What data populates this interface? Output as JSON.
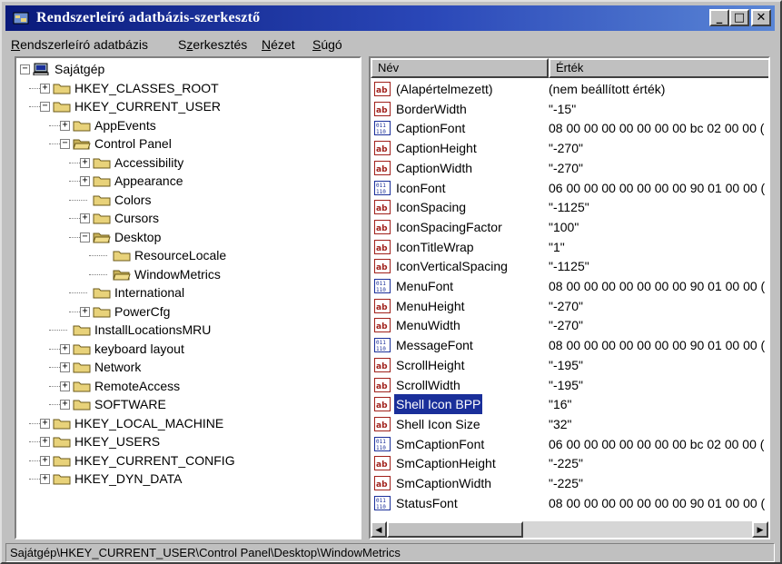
{
  "window": {
    "title": "Rendszerleíró adatbázis-szerkesztő",
    "controls": {
      "minimize": "_",
      "maximize": "□",
      "close": "✕"
    }
  },
  "menu": [
    {
      "label": "Rendszerleíró adatbázis",
      "accel": "R",
      "rest": "endszerleíró adatbázis"
    },
    {
      "label": "Szerkesztés",
      "accel": "z",
      "pre": "S",
      "rest": "erkesztés"
    },
    {
      "label": "Nézet",
      "accel": "N",
      "rest": "ézet"
    },
    {
      "label": "Súgó",
      "accel": "S",
      "rest": "úgó"
    }
  ],
  "tree": [
    {
      "label": "Sajátgép",
      "depth": 0,
      "expander": "−",
      "icon": "computer-icon"
    },
    {
      "label": "HKEY_CLASSES_ROOT",
      "depth": 1,
      "expander": "+",
      "icon": "folder-icon"
    },
    {
      "label": "HKEY_CURRENT_USER",
      "depth": 1,
      "expander": "−",
      "icon": "folder-icon"
    },
    {
      "label": "AppEvents",
      "depth": 2,
      "expander": "+",
      "icon": "folder-icon"
    },
    {
      "label": "Control Panel",
      "depth": 2,
      "expander": "−",
      "icon": "folder-open-icon"
    },
    {
      "label": "Accessibility",
      "depth": 3,
      "expander": "+",
      "icon": "folder-icon"
    },
    {
      "label": "Appearance",
      "depth": 3,
      "expander": "+",
      "icon": "folder-icon"
    },
    {
      "label": "Colors",
      "depth": 3,
      "expander": "",
      "icon": "folder-icon"
    },
    {
      "label": "Cursors",
      "depth": 3,
      "expander": "+",
      "icon": "folder-icon"
    },
    {
      "label": "Desktop",
      "depth": 3,
      "expander": "−",
      "icon": "folder-open-icon"
    },
    {
      "label": "ResourceLocale",
      "depth": 4,
      "expander": "",
      "icon": "folder-icon"
    },
    {
      "label": "WindowMetrics",
      "depth": 4,
      "expander": "",
      "icon": "folder-open-icon"
    },
    {
      "label": "International",
      "depth": 3,
      "expander": "",
      "icon": "folder-icon"
    },
    {
      "label": "PowerCfg",
      "depth": 3,
      "expander": "+",
      "icon": "folder-icon"
    },
    {
      "label": "InstallLocationsMRU",
      "depth": 2,
      "expander": "",
      "icon": "folder-icon"
    },
    {
      "label": "keyboard layout",
      "depth": 2,
      "expander": "+",
      "icon": "folder-icon"
    },
    {
      "label": "Network",
      "depth": 2,
      "expander": "+",
      "icon": "folder-icon"
    },
    {
      "label": "RemoteAccess",
      "depth": 2,
      "expander": "+",
      "icon": "folder-icon"
    },
    {
      "label": "SOFTWARE",
      "depth": 2,
      "expander": "+",
      "icon": "folder-icon"
    },
    {
      "label": "HKEY_LOCAL_MACHINE",
      "depth": 1,
      "expander": "+",
      "icon": "folder-icon"
    },
    {
      "label": "HKEY_USERS",
      "depth": 1,
      "expander": "+",
      "icon": "folder-icon"
    },
    {
      "label": "HKEY_CURRENT_CONFIG",
      "depth": 1,
      "expander": "+",
      "icon": "folder-icon"
    },
    {
      "label": "HKEY_DYN_DATA",
      "depth": 1,
      "expander": "+",
      "icon": "folder-icon"
    }
  ],
  "list": {
    "headers": {
      "name": "Név",
      "value": "Érték"
    },
    "rows": [
      {
        "name": "(Alapértelmezett)",
        "type": "string",
        "value": "(nem beállított érték)"
      },
      {
        "name": "BorderWidth",
        "type": "string",
        "value": "\"-15\""
      },
      {
        "name": "CaptionFont",
        "type": "binary",
        "value": "08 00 00 00 00 00 00 00 bc 02 00 00 ("
      },
      {
        "name": "CaptionHeight",
        "type": "string",
        "value": "\"-270\""
      },
      {
        "name": "CaptionWidth",
        "type": "string",
        "value": "\"-270\""
      },
      {
        "name": "IconFont",
        "type": "binary",
        "value": "06 00 00 00 00 00 00 00 90 01 00 00 ("
      },
      {
        "name": "IconSpacing",
        "type": "string",
        "value": "\"-1125\""
      },
      {
        "name": "IconSpacingFactor",
        "type": "string",
        "value": "\"100\""
      },
      {
        "name": "IconTitleWrap",
        "type": "string",
        "value": "\"1\""
      },
      {
        "name": "IconVerticalSpacing",
        "type": "string",
        "value": "\"-1125\""
      },
      {
        "name": "MenuFont",
        "type": "binary",
        "value": "08 00 00 00 00 00 00 00 90 01 00 00 ("
      },
      {
        "name": "MenuHeight",
        "type": "string",
        "value": "\"-270\""
      },
      {
        "name": "MenuWidth",
        "type": "string",
        "value": "\"-270\""
      },
      {
        "name": "MessageFont",
        "type": "binary",
        "value": "08 00 00 00 00 00 00 00 90 01 00 00 ("
      },
      {
        "name": "ScrollHeight",
        "type": "string",
        "value": "\"-195\""
      },
      {
        "name": "ScrollWidth",
        "type": "string",
        "value": "\"-195\""
      },
      {
        "name": "Shell Icon BPP",
        "type": "string",
        "value": "\"16\"",
        "selected": true
      },
      {
        "name": "Shell Icon Size",
        "type": "string",
        "value": "\"32\""
      },
      {
        "name": "SmCaptionFont",
        "type": "binary",
        "value": "06 00 00 00 00 00 00 00 bc 02 00 00 ("
      },
      {
        "name": "SmCaptionHeight",
        "type": "string",
        "value": "\"-225\""
      },
      {
        "name": "SmCaptionWidth",
        "type": "string",
        "value": "\"-225\""
      },
      {
        "name": "StatusFont",
        "type": "binary",
        "value": "08 00 00 00 00 00 00 00 90 01 00 00 ("
      }
    ]
  },
  "scrollbar": {
    "left_arrow": "◀",
    "right_arrow": "▶"
  },
  "status": "Sajátgép\\HKEY_CURRENT_USER\\Control Panel\\Desktop\\WindowMetrics",
  "colors": {
    "title_start": "#0a1a7a",
    "title_end": "#5a86d6",
    "selection": "#1a2f9a",
    "folder": "#e8d27a"
  }
}
